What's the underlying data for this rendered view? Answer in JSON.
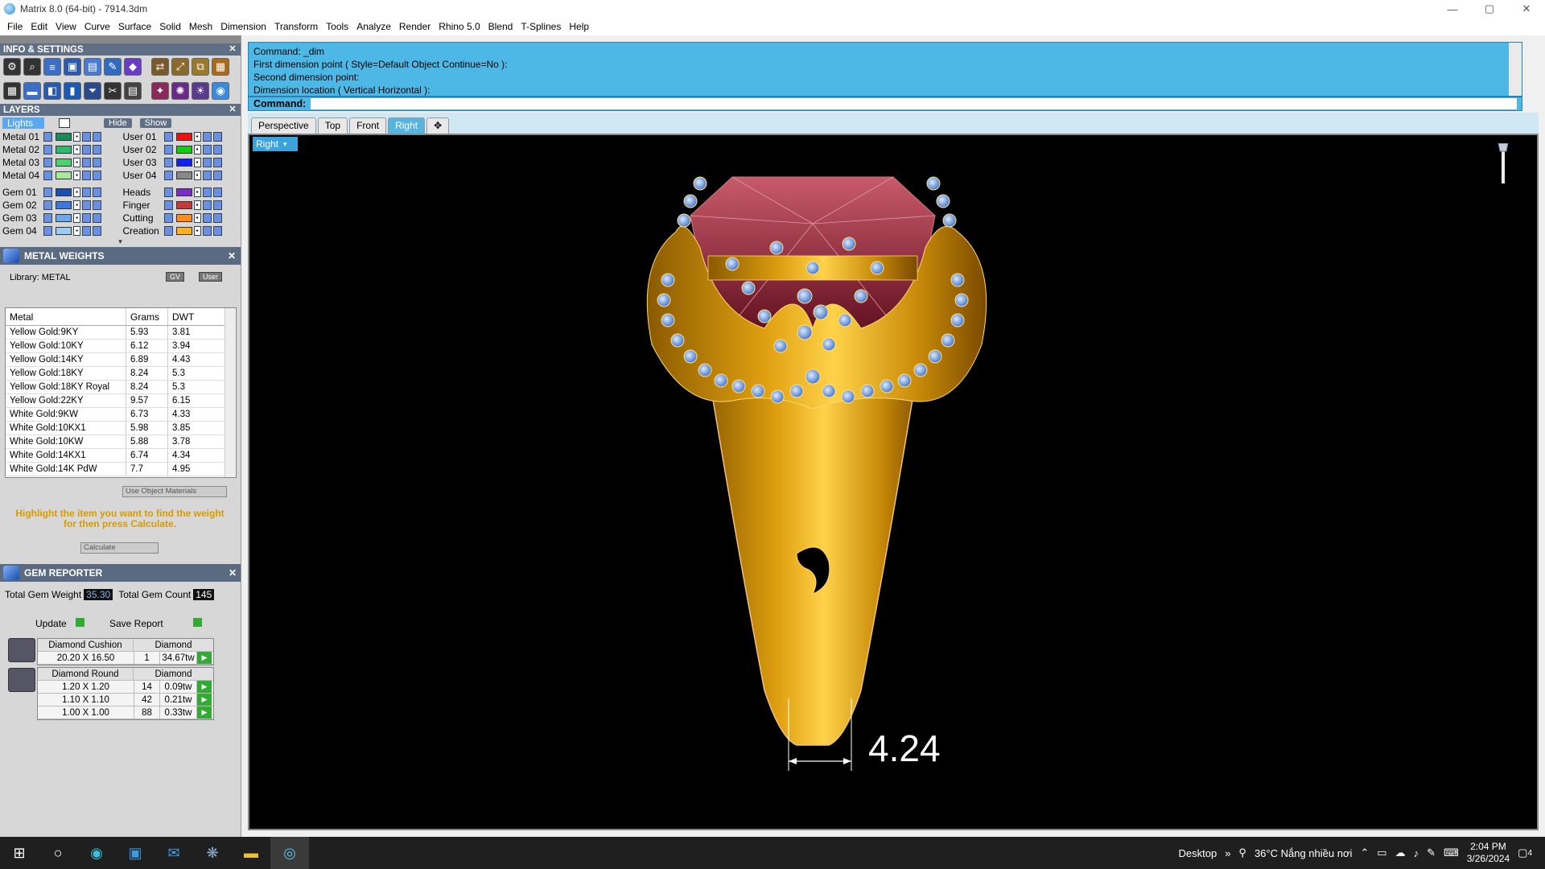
{
  "window": {
    "title": "Matrix 8.0 (64-bit) - 7914.3dm",
    "min": "—",
    "max": "▢",
    "close": "✕"
  },
  "menu": [
    "File",
    "Edit",
    "View",
    "Curve",
    "Surface",
    "Solid",
    "Mesh",
    "Dimension",
    "Transform",
    "Tools",
    "Analyze",
    "Render",
    "Rhino 5.0",
    "Blend",
    "T-Splines",
    "Help"
  ],
  "panels": {
    "info": {
      "title": "INFO & SETTINGS",
      "close": "✕"
    },
    "layers": {
      "title": "LAYERS",
      "close": "✕",
      "lights": "Lights",
      "hide": "Hide",
      "show": "Show",
      "left": [
        {
          "name": "Metal 01",
          "color": "#1a8a5a"
        },
        {
          "name": "Metal 02",
          "color": "#2fb86f"
        },
        {
          "name": "Metal 03",
          "color": "#4fd070"
        },
        {
          "name": "Metal 04",
          "color": "#a8e8a0"
        },
        {
          "name": "Gem 01",
          "color": "#1a4fb0"
        },
        {
          "name": "Gem 02",
          "color": "#3a7ae0"
        },
        {
          "name": "Gem 03",
          "color": "#6aa8f0"
        },
        {
          "name": "Gem 04",
          "color": "#9ccdf8"
        }
      ],
      "right": [
        {
          "name": "User 01",
          "color": "#ee1111"
        },
        {
          "name": "User 02",
          "color": "#11cc11"
        },
        {
          "name": "User 03",
          "color": "#1122ee"
        },
        {
          "name": "User 04",
          "color": "#888888"
        },
        {
          "name": "Heads",
          "color": "#7a2cc8"
        },
        {
          "name": "Finger",
          "color": "#c83a3a"
        },
        {
          "name": "Cutting",
          "color": "#ff8c1a"
        },
        {
          "name": "Creation",
          "color": "#ffb21a"
        }
      ]
    },
    "metal": {
      "title": "METAL WEIGHTS",
      "close": "✕",
      "library": "Library: METAL",
      "gv": "GV",
      "user": "User",
      "headers": [
        "Metal",
        "Grams",
        "DWT"
      ],
      "rows": [
        [
          "Yellow Gold:9KY",
          "5.93",
          "3.81"
        ],
        [
          "Yellow Gold:10KY",
          "6.12",
          "3.94"
        ],
        [
          "Yellow Gold:14KY",
          "6.89",
          "4.43"
        ],
        [
          "Yellow Gold:18KY",
          "8.24",
          "5.3"
        ],
        [
          "Yellow Gold:18KY Royal",
          "8.24",
          "5.3"
        ],
        [
          "Yellow Gold:22KY",
          "9.57",
          "6.15"
        ],
        [
          "White Gold:9KW",
          "6.73",
          "4.33"
        ],
        [
          "White Gold:10KX1",
          "5.98",
          "3.85"
        ],
        [
          "White Gold:10KW",
          "5.88",
          "3.78"
        ],
        [
          "White Gold:14KX1",
          "6.74",
          "4.34"
        ],
        [
          "White Gold:14K PdW",
          "7.7",
          "4.95"
        ]
      ],
      "use_object_materials": "Use Object Materials",
      "hint": "Highlight the item you want to find the weight for then press Calculate.",
      "calculate": "Calculate"
    },
    "gem": {
      "title": "GEM REPORTER",
      "close": "✕",
      "total_weight_label": "Total Gem Weight",
      "total_weight": "35.30",
      "total_count_label": "Total Gem Count",
      "total_count": "145",
      "update": "Update",
      "save_report": "Save Report",
      "cushion": {
        "shape": "Diamond Cushion",
        "material": "Diamond",
        "rows": [
          [
            "20.20 X 16.50",
            "1",
            "34.67tw"
          ]
        ]
      },
      "round": {
        "shape": "Diamond Round",
        "material": "Diamond",
        "rows": [
          [
            "1.20 X 1.20",
            "14",
            "0.09tw"
          ],
          [
            "1.10 X 1.10",
            "42",
            "0.21tw"
          ],
          [
            "1.00 X 1.00",
            "88",
            "0.33tw"
          ]
        ]
      }
    }
  },
  "command": {
    "lines": [
      "Command: _dim",
      "First dimension point ( Style=Default  Object  Continue=No ):",
      "Second dimension point:",
      "Dimension location ( Vertical  Horizontal ):"
    ],
    "prompt": "Command:"
  },
  "viewport": {
    "tabs": [
      "Perspective",
      "Top",
      "Front",
      "Right"
    ],
    "active_tab": "Right",
    "add_tab": "✥",
    "label": "Right",
    "dimension": "4.24"
  },
  "taskbar": {
    "desktop": "Desktop",
    "weather": "36°C  Nắng nhiều nơi",
    "time": "2:04 PM",
    "date": "3/26/2024",
    "notifications": "4"
  }
}
